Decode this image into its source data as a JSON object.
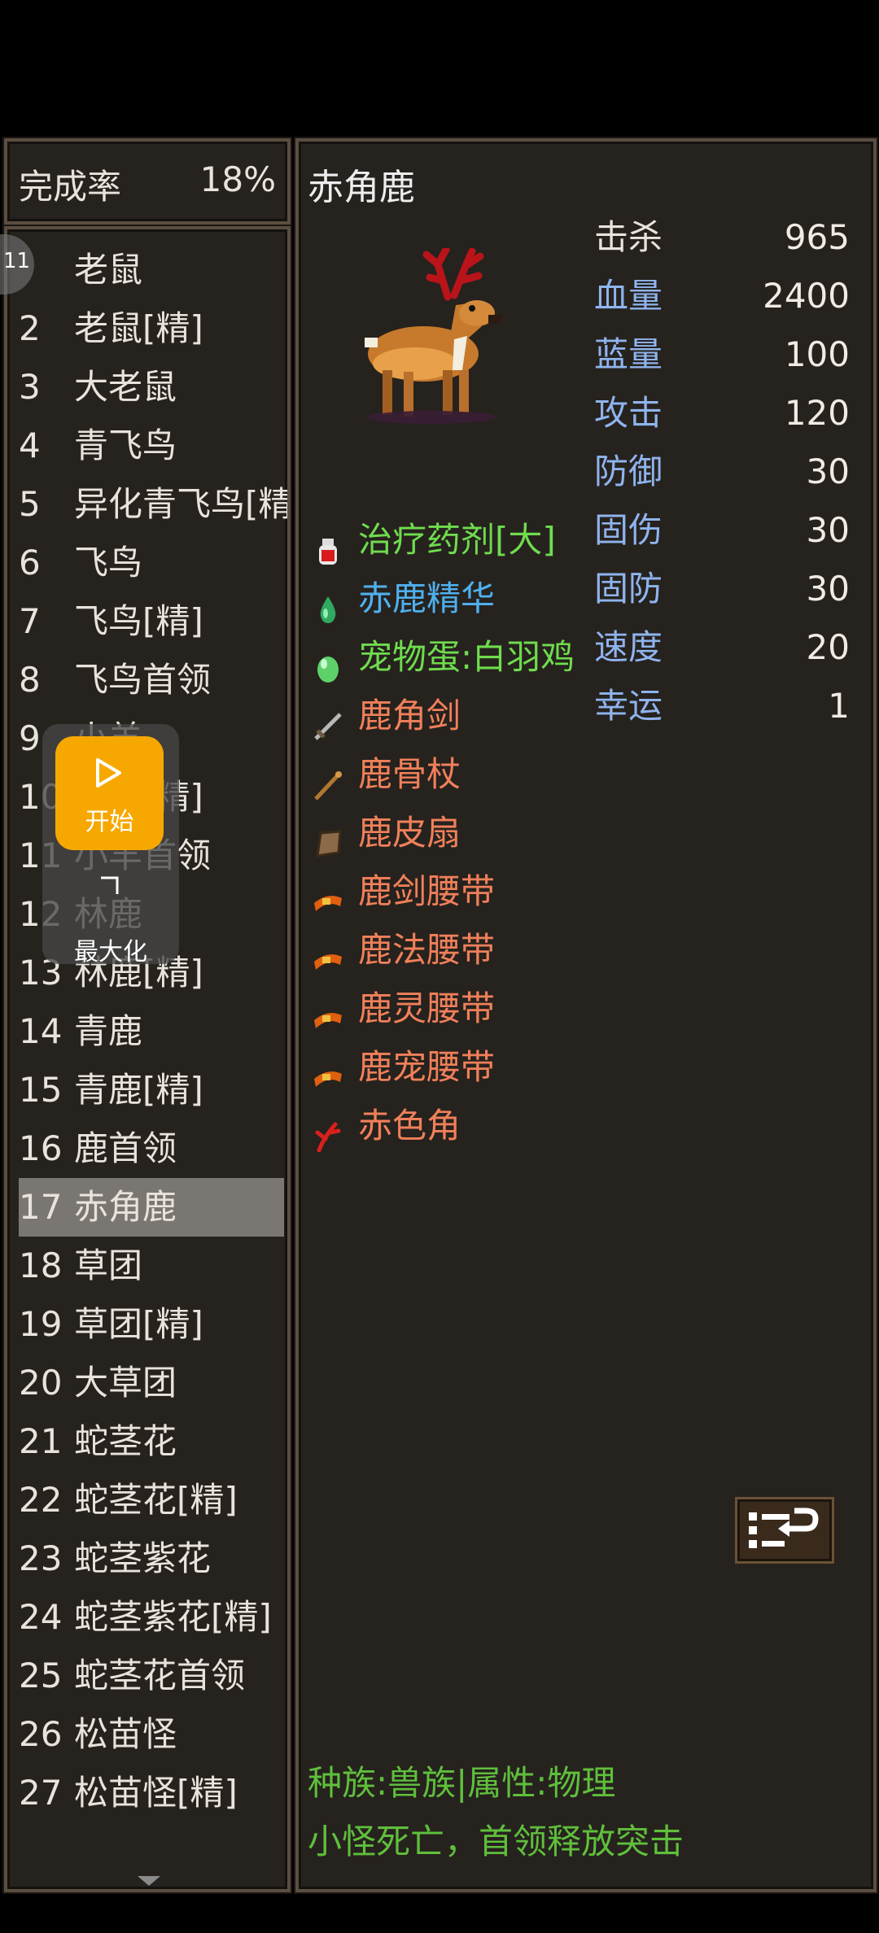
{
  "completion": {
    "label": "完成率",
    "value": "18%"
  },
  "float_tab": {
    "label": "11"
  },
  "monster_list": [
    {
      "num": "",
      "name": "老鼠"
    },
    {
      "num": "2",
      "name": "老鼠[精]"
    },
    {
      "num": "3",
      "name": "大老鼠"
    },
    {
      "num": "4",
      "name": "青飞鸟"
    },
    {
      "num": "5",
      "name": "异化青飞鸟[精]"
    },
    {
      "num": "6",
      "name": "飞鸟"
    },
    {
      "num": "7",
      "name": "飞鸟[精]"
    },
    {
      "num": "8",
      "name": "飞鸟首领"
    },
    {
      "num": "9",
      "name": "小羊"
    },
    {
      "num": "10",
      "name": "小羊[精]"
    },
    {
      "num": "11",
      "name": "小羊首领"
    },
    {
      "num": "12",
      "name": "林鹿"
    },
    {
      "num": "13",
      "name": "林鹿[精]"
    },
    {
      "num": "14",
      "name": "青鹿"
    },
    {
      "num": "15",
      "name": "青鹿[精]"
    },
    {
      "num": "16",
      "name": "鹿首领"
    },
    {
      "num": "17",
      "name": "赤角鹿"
    },
    {
      "num": "18",
      "name": "草团"
    },
    {
      "num": "19",
      "name": "草团[精]"
    },
    {
      "num": "20",
      "name": "大草团"
    },
    {
      "num": "21",
      "name": "蛇茎花"
    },
    {
      "num": "22",
      "name": "蛇茎花[精]"
    },
    {
      "num": "23",
      "name": "蛇茎紫花"
    },
    {
      "num": "24",
      "name": "蛇茎紫花[精]"
    },
    {
      "num": "25",
      "name": "蛇茎花首领"
    },
    {
      "num": "26",
      "name": "松苗怪"
    },
    {
      "num": "27",
      "name": "松苗怪[精]"
    }
  ],
  "selected_index": 16,
  "overlay": {
    "start_label": "开始",
    "maximize_label": "最大化"
  },
  "monster": {
    "name": "赤角鹿",
    "stats": [
      {
        "key": "击杀",
        "value": "965",
        "color": "#e8e4dc"
      },
      {
        "key": "血量",
        "value": "2400",
        "color": "#8fb4ee"
      },
      {
        "key": "蓝量",
        "value": "100",
        "color": "#8fb4ee"
      },
      {
        "key": "攻击",
        "value": "120",
        "color": "#8fb4ee"
      },
      {
        "key": "防御",
        "value": "30",
        "color": "#8fb4ee"
      },
      {
        "key": "固伤",
        "value": "30",
        "color": "#8fb4ee"
      },
      {
        "key": "固防",
        "value": "30",
        "color": "#8fb4ee"
      },
      {
        "key": "速度",
        "value": "20",
        "color": "#8fb4ee"
      },
      {
        "key": "幸运",
        "value": "1",
        "color": "#8fb4ee"
      }
    ],
    "drops": [
      {
        "name": "治疗药剂[大]",
        "color": "#6fdc4e",
        "icon": "potion-icon"
      },
      {
        "name": "赤鹿精华",
        "color": "#4fb0ee",
        "icon": "essence-drop-icon"
      },
      {
        "name": "宠物蛋:白羽鸡",
        "color": "#6fdc4e",
        "icon": "pet-egg-icon"
      },
      {
        "name": "鹿角剑",
        "color": "#f0805a",
        "icon": "sword-icon"
      },
      {
        "name": "鹿骨杖",
        "color": "#f0805a",
        "icon": "staff-icon"
      },
      {
        "name": "鹿皮扇",
        "color": "#f0805a",
        "icon": "fan-icon"
      },
      {
        "name": "鹿剑腰带",
        "color": "#f0805a",
        "icon": "belt-icon"
      },
      {
        "name": "鹿法腰带",
        "color": "#f0805a",
        "icon": "belt-icon"
      },
      {
        "name": "鹿灵腰带",
        "color": "#f0805a",
        "icon": "belt-icon"
      },
      {
        "name": "鹿宠腰带",
        "color": "#f0805a",
        "icon": "belt-icon"
      },
      {
        "name": "赤色角",
        "color": "#f0805a",
        "icon": "red-horn-icon"
      }
    ],
    "race_line": "种族:兽族|属性:物理",
    "skill_line": "小怪死亡，首领释放突击"
  }
}
